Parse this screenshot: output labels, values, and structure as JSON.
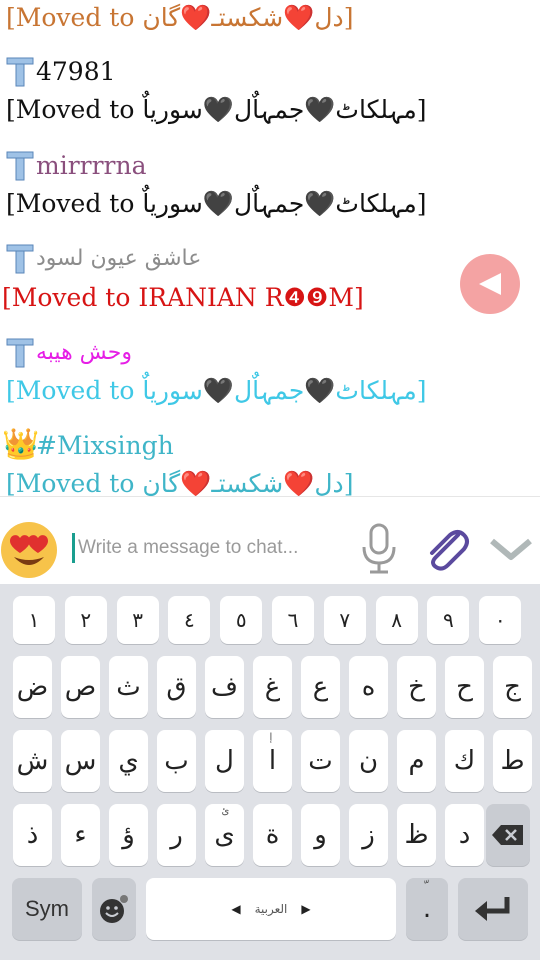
{
  "chat": {
    "messages": [
      {
        "id": "m1",
        "sender": "",
        "sender_color": "#c87533",
        "text": "[Moved to دل❤️شکستـ❤️گان]",
        "text_color": "#c87533",
        "icon": ""
      },
      {
        "id": "m2",
        "sender": "47981",
        "sender_color": "#111111",
        "text": "[Moved to مہلکاٹ🖤جمہاٌل🖤سوریاٌ]",
        "text_color": "#111111",
        "icon": "t-icon"
      },
      {
        "id": "m3",
        "sender": "mirrrrna",
        "sender_color": "#8a4f7d",
        "text": "[Moved to مہلکاٹ🖤جمہاٌل🖤سوریاٌ]",
        "text_color": "#111111",
        "icon": "t-icon"
      },
      {
        "id": "m4",
        "sender": "عاشق عیون لسود",
        "sender_color": "#8c8c8c",
        "text": "[Moved to IRANIAN R❹❾M]",
        "text_color": "#d71414",
        "icon": "t-icon"
      },
      {
        "id": "m5",
        "sender": "وحش هيبه",
        "sender_color": "#e61ee6",
        "text": "[Moved to مہلکاٹ🖤جمہاٌل🖤سوریاٌ]",
        "text_color": "#3fc8e6",
        "icon": "t-icon"
      },
      {
        "id": "m6",
        "sender": "#Mixsingh",
        "sender_color": "#3fb5c8",
        "text": "[Moved to دل❤️شکستـ❤️گان]",
        "text_color": "#3fb5c8",
        "icon": "crown-icon"
      }
    ]
  },
  "composer": {
    "placeholder": "Write a message to chat...",
    "value": ""
  },
  "keyboard": {
    "row_numbers": [
      "١",
      "٢",
      "٣",
      "٤",
      "٥",
      "٦",
      "٧",
      "٨",
      "٩",
      "٠"
    ],
    "row1": [
      "ض",
      "ص",
      "ث",
      "ق",
      "ف",
      "غ",
      "ع",
      "ه",
      "خ",
      "ح",
      "ج"
    ],
    "row2": [
      "ش",
      "س",
      "ي",
      "ب",
      "ل",
      "ا",
      "ت",
      "ن",
      "م",
      "ك",
      "ط"
    ],
    "row2_hints": [
      "",
      "",
      "",
      "",
      "",
      "إ",
      "",
      "",
      "",
      "",
      ""
    ],
    "row3": [
      "ذ",
      "ء",
      "ؤ",
      "ر",
      "ى",
      "ة",
      "و",
      "ز",
      "ظ",
      "د"
    ],
    "row3_hints": [
      "",
      "",
      "",
      "",
      "ئ",
      "",
      "",
      "",
      "",
      ""
    ],
    "sym_label": "Sym",
    "space_label": "العربية",
    "period_label": ".",
    "period_hint": "ّ"
  },
  "colors": {
    "accent": "#1a9e8f",
    "play_button": "#f4a3a3",
    "keyboard_bg": "#dfe1e6",
    "attach_icon": "#5b4a9e"
  }
}
